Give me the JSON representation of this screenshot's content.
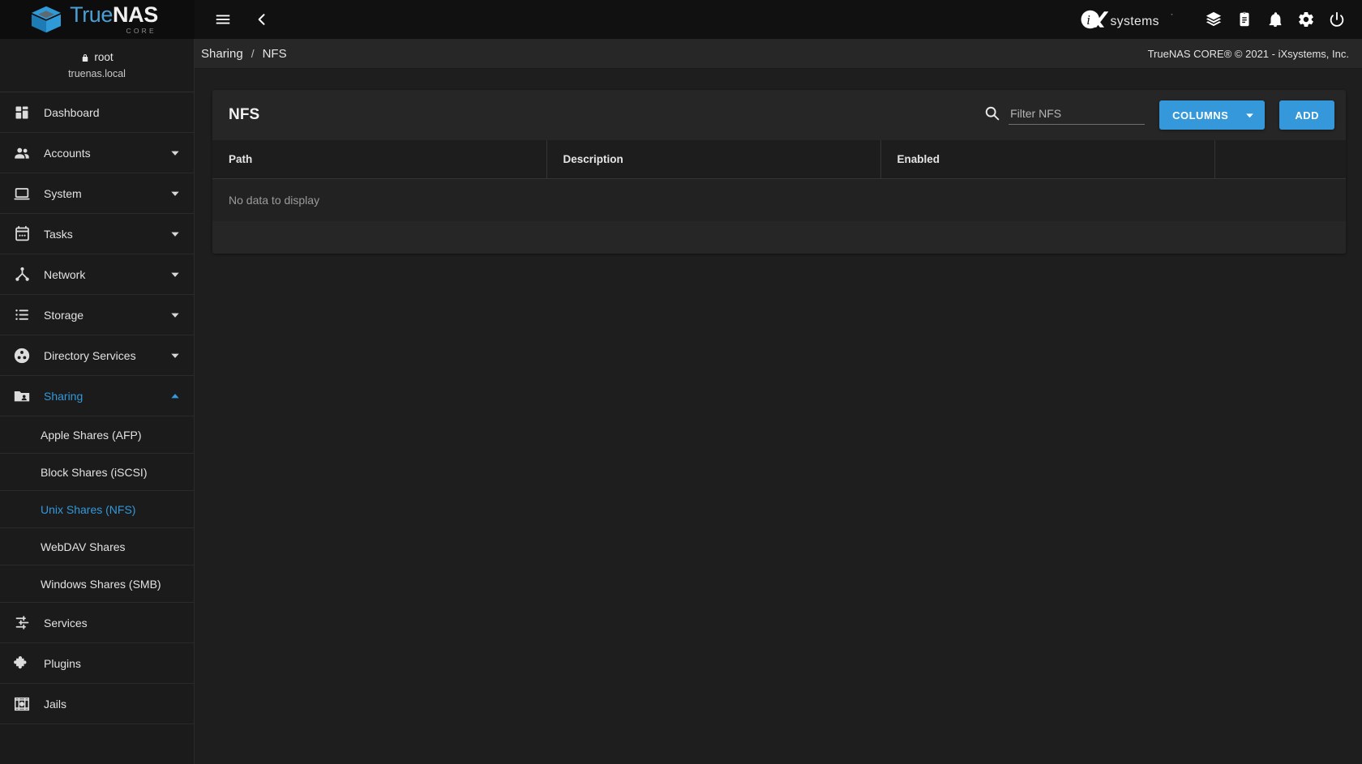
{
  "brand": {
    "name_part1": "True",
    "name_part2": "NAS",
    "edition": "CORE",
    "vendor_logo": "ixsystems-logo",
    "vendor_name": "iXsystems"
  },
  "topbar": {
    "menu_icon": "hamburger-menu-icon",
    "back_icon": "chevron-left-icon",
    "icons": [
      {
        "name": "layers-icon",
        "label": "Layers"
      },
      {
        "name": "clipboard-icon",
        "label": "Task Manager"
      },
      {
        "name": "bell-icon",
        "label": "Alerts"
      },
      {
        "name": "gear-icon",
        "label": "Settings"
      },
      {
        "name": "power-icon",
        "label": "Power"
      }
    ]
  },
  "sidebar": {
    "user": {
      "lock_icon": "lock-icon",
      "username": "root",
      "hostname": "truenas.local"
    },
    "items": [
      {
        "label": "Dashboard",
        "icon": "dashboard-grid-icon",
        "expandable": false,
        "active": false
      },
      {
        "label": "Accounts",
        "icon": "people-icon",
        "expandable": true,
        "expanded": false,
        "active": false
      },
      {
        "label": "System",
        "icon": "laptop-icon",
        "expandable": true,
        "expanded": false,
        "active": false
      },
      {
        "label": "Tasks",
        "icon": "calendar-icon",
        "expandable": true,
        "expanded": false,
        "active": false
      },
      {
        "label": "Network",
        "icon": "network-hierarchy-icon",
        "expandable": true,
        "expanded": false,
        "active": false
      },
      {
        "label": "Storage",
        "icon": "storage-list-icon",
        "expandable": true,
        "expanded": false,
        "active": false
      },
      {
        "label": "Directory Services",
        "icon": "directory-services-icon",
        "expandable": true,
        "expanded": false,
        "active": false
      },
      {
        "label": "Sharing",
        "icon": "sharing-folder-icon",
        "expandable": true,
        "expanded": true,
        "active": true
      }
    ],
    "sharing_children": [
      {
        "label": "Apple Shares (AFP)",
        "active": false
      },
      {
        "label": "Block Shares (iSCSI)",
        "active": false
      },
      {
        "label": "Unix Shares (NFS)",
        "active": true
      },
      {
        "label": "WebDAV Shares",
        "active": false
      },
      {
        "label": "Windows Shares (SMB)",
        "active": false
      }
    ],
    "items_after": [
      {
        "label": "Services",
        "icon": "sliders-icon",
        "expandable": false,
        "active": false
      },
      {
        "label": "Plugins",
        "icon": "puzzle-piece-icon",
        "expandable": false,
        "active": false
      },
      {
        "label": "Jails",
        "icon": "jails-icon",
        "expandable": false,
        "active": false
      }
    ]
  },
  "breadcrumb": {
    "parent": "Sharing",
    "separator": "/",
    "current": "NFS"
  },
  "footer": {
    "copyright": "TrueNAS CORE® © 2021 - iXsystems, Inc."
  },
  "card": {
    "title": "NFS",
    "search_icon": "search-icon",
    "filter_placeholder": "Filter NFS",
    "filter_value": "",
    "columns_button": "COLUMNS",
    "columns_chevron_icon": "chevron-down-icon",
    "add_button": "ADD"
  },
  "table": {
    "headers": [
      "Path",
      "Description",
      "Enabled",
      ""
    ],
    "rows": [],
    "empty_message": "No data to display"
  },
  "colors": {
    "accent": "#3498db",
    "topbar_bg": "#111111",
    "sidebar_bg": "#1b1b1b",
    "content_bg": "#1e1e1e",
    "card_bg": "#262626",
    "logo_blue": "#4a9fd5"
  }
}
